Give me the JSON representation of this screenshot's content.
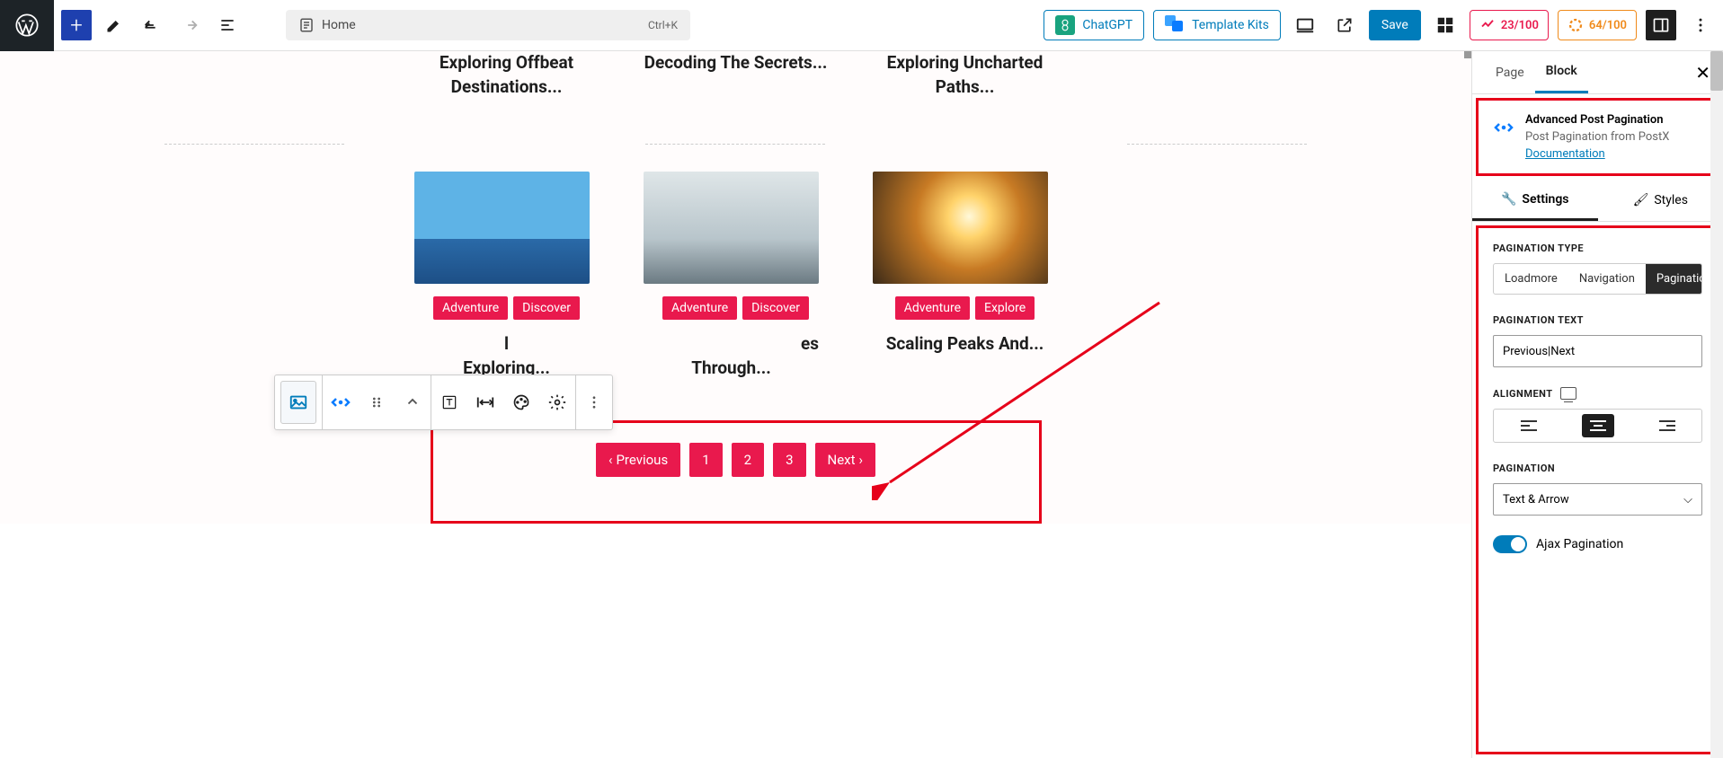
{
  "topbar": {
    "doc_title": "Home",
    "shortcut": "Ctrl+K",
    "chatgpt_label": "ChatGPT",
    "template_kits_label": "Template Kits",
    "save_label": "Save",
    "score_red": "23/100",
    "score_orange": "64/100"
  },
  "posts_top": [
    {
      "title": "Exploring Offbeat Destinations..."
    },
    {
      "title": "Decoding The Secrets..."
    },
    {
      "title": "Exploring Uncharted Paths..."
    }
  ],
  "posts_mid": [
    {
      "tags": [
        "Adventure",
        "Discover"
      ],
      "title_a": "l",
      "title_b": "Exploring..."
    },
    {
      "tags": [
        "Adventure",
        "Discover"
      ],
      "title_a": "es",
      "title_b": "Through..."
    },
    {
      "tags": [
        "Adventure",
        "Explore"
      ],
      "title_a": "Scaling Peaks And...",
      "title_b": ""
    }
  ],
  "pagination": {
    "prev": "Previous",
    "pages": [
      "1",
      "2",
      "3"
    ],
    "next": "Next"
  },
  "sidebar": {
    "tab_page": "Page",
    "tab_block": "Block",
    "block_title": "Advanced Post Pagination",
    "block_desc": "Post Pagination from PostX",
    "doc_link": "Documentation",
    "sub_settings": "Settings",
    "sub_styles": "Styles",
    "lbl_pag_type": "PAGINATION TYPE",
    "type_options": {
      "loadmore": "Loadmore",
      "navigation": "Navigation",
      "pagination": "Pagination"
    },
    "lbl_pag_text": "PAGINATION TEXT",
    "pag_text_value": "Previous|Next",
    "lbl_alignment": "ALIGNMENT",
    "lbl_pagination": "PAGINATION",
    "pagination_select": "Text & Arrow",
    "ajax_label": "Ajax Pagination"
  }
}
